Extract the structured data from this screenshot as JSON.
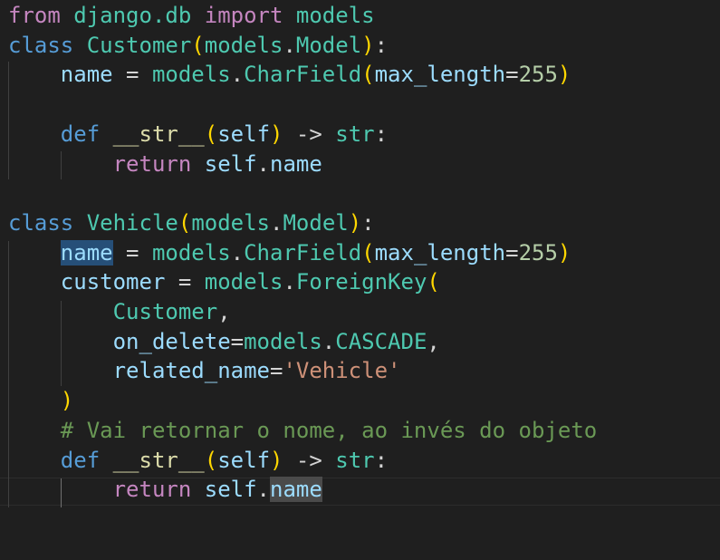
{
  "lines": [
    {
      "tokens": [
        [
          "kw",
          "from"
        ],
        [
          "op",
          " "
        ],
        [
          "cls",
          "django.db"
        ],
        [
          "op",
          " "
        ],
        [
          "kw",
          "import"
        ],
        [
          "op",
          " "
        ],
        [
          "cls",
          "models"
        ]
      ]
    },
    {
      "tokens": [
        [
          "st",
          "class"
        ],
        [
          "op",
          " "
        ],
        [
          "cls",
          "Customer"
        ],
        [
          "b1",
          "("
        ],
        [
          "cls",
          "models"
        ],
        [
          "op",
          "."
        ],
        [
          "cls",
          "Model"
        ],
        [
          "b1",
          ")"
        ],
        [
          "op",
          ":"
        ]
      ]
    },
    {
      "tokens": [
        [
          "op",
          "    "
        ],
        [
          "var",
          "name"
        ],
        [
          "op",
          " = "
        ],
        [
          "cls",
          "models"
        ],
        [
          "op",
          "."
        ],
        [
          "cls",
          "CharField"
        ],
        [
          "b1",
          "("
        ],
        [
          "var",
          "max_length"
        ],
        [
          "op",
          "="
        ],
        [
          "num",
          "255"
        ],
        [
          "b1",
          ")"
        ]
      ]
    },
    {
      "tokens": []
    },
    {
      "tokens": [
        [
          "op",
          "    "
        ],
        [
          "st",
          "def"
        ],
        [
          "op",
          " "
        ],
        [
          "fn",
          "__str__"
        ],
        [
          "b1",
          "("
        ],
        [
          "var",
          "self"
        ],
        [
          "b1",
          ")"
        ],
        [
          "op",
          " -> "
        ],
        [
          "cls",
          "str"
        ],
        [
          "op",
          ":"
        ]
      ]
    },
    {
      "tokens": [
        [
          "op",
          "        "
        ],
        [
          "kw",
          "return"
        ],
        [
          "op",
          " "
        ],
        [
          "var",
          "self"
        ],
        [
          "op",
          "."
        ],
        [
          "var",
          "name"
        ]
      ]
    },
    {
      "tokens": []
    },
    {
      "tokens": [
        [
          "st",
          "class"
        ],
        [
          "op",
          " "
        ],
        [
          "cls",
          "Vehicle"
        ],
        [
          "b1",
          "("
        ],
        [
          "cls",
          "models"
        ],
        [
          "op",
          "."
        ],
        [
          "cls",
          "Model"
        ],
        [
          "b1",
          ")"
        ],
        [
          "op",
          ":"
        ]
      ]
    },
    {
      "tokens": [
        [
          "op",
          "    "
        ],
        [
          "var hl-sel",
          "name"
        ],
        [
          "op",
          " = "
        ],
        [
          "cls",
          "models"
        ],
        [
          "op",
          "."
        ],
        [
          "cls",
          "CharField"
        ],
        [
          "b1",
          "("
        ],
        [
          "var",
          "max_length"
        ],
        [
          "op",
          "="
        ],
        [
          "num",
          "255"
        ],
        [
          "b1",
          ")"
        ]
      ]
    },
    {
      "tokens": [
        [
          "op",
          "    "
        ],
        [
          "var",
          "customer"
        ],
        [
          "op",
          " = "
        ],
        [
          "cls",
          "models"
        ],
        [
          "op",
          "."
        ],
        [
          "cls",
          "ForeignKey"
        ],
        [
          "b1",
          "("
        ]
      ]
    },
    {
      "tokens": [
        [
          "op",
          "        "
        ],
        [
          "cls",
          "Customer"
        ],
        [
          "op",
          ","
        ]
      ]
    },
    {
      "tokens": [
        [
          "op",
          "        "
        ],
        [
          "var",
          "on_delete"
        ],
        [
          "op",
          "="
        ],
        [
          "cls",
          "models"
        ],
        [
          "op",
          "."
        ],
        [
          "cls",
          "CASCADE"
        ],
        [
          "op",
          ","
        ]
      ]
    },
    {
      "tokens": [
        [
          "op",
          "        "
        ],
        [
          "var",
          "related_name"
        ],
        [
          "op",
          "="
        ],
        [
          "str",
          "'Vehicle'"
        ]
      ]
    },
    {
      "tokens": [
        [
          "op",
          "    "
        ],
        [
          "b1",
          ")"
        ]
      ]
    },
    {
      "tokens": [
        [
          "op",
          "    "
        ],
        [
          "cmt",
          "# Vai retornar o nome, ao invés do objeto"
        ]
      ]
    },
    {
      "tokens": [
        [
          "op",
          "    "
        ],
        [
          "st",
          "def"
        ],
        [
          "op",
          " "
        ],
        [
          "fn",
          "__str__"
        ],
        [
          "b1",
          "("
        ],
        [
          "var",
          "self"
        ],
        [
          "b1",
          ")"
        ],
        [
          "op",
          " -> "
        ],
        [
          "cls",
          "str"
        ],
        [
          "op",
          ":"
        ]
      ]
    },
    {
      "tokens": [
        [
          "op",
          "        "
        ],
        [
          "kw",
          "return"
        ],
        [
          "op",
          " "
        ],
        [
          "var",
          "self"
        ],
        [
          "op",
          "."
        ],
        [
          "var hl-word",
          "name"
        ]
      ]
    }
  ]
}
